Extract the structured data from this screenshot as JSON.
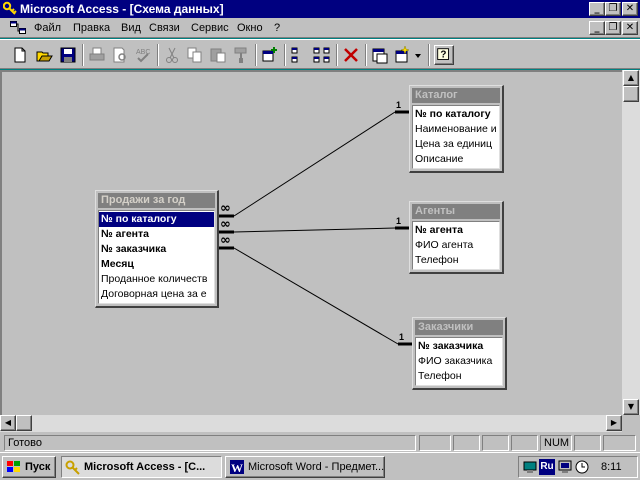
{
  "window": {
    "title": "Microsoft Access - [Схема данных]",
    "controls": {
      "minimize": "_",
      "restore": "❐",
      "close": "✕"
    }
  },
  "menu": {
    "items": [
      {
        "label": "Файл"
      },
      {
        "label": "Правка"
      },
      {
        "label": "Вид"
      },
      {
        "label": "Связи"
      },
      {
        "label": "Сервис"
      },
      {
        "label": "Окно"
      },
      {
        "label": "?"
      }
    ]
  },
  "toolbar": {
    "icons": [
      "new-icon",
      "open-icon",
      "save-icon",
      "print-icon",
      "print-preview-icon",
      "spelling-icon",
      "cut-icon",
      "copy-icon",
      "paste-icon",
      "format-painter-icon",
      "show-table-icon",
      "show-direct-icon",
      "show-all-icon",
      "delete-icon",
      "properties-icon",
      "new-object-icon",
      "help-icon"
    ]
  },
  "tables": {
    "sales": {
      "title": "Продажи за год",
      "fields": [
        "№ по каталогу",
        "№ агента",
        "№ заказчика",
        "Месяц",
        "Проданное количеств",
        "Договорная цена за е"
      ]
    },
    "catalog": {
      "title": "Каталог",
      "fields": [
        "№ по каталогу",
        "Наименование и",
        "Цена за единиц",
        "Описание"
      ]
    },
    "agents": {
      "title": "Агенты",
      "fields": [
        "№ агента",
        "ФИО агента",
        "Телефон"
      ]
    },
    "customers": {
      "title": "Заказчики",
      "fields": [
        "№ заказчика",
        "ФИО заказчика",
        "Телефон"
      ]
    }
  },
  "relations": {
    "one_label": "1",
    "many_label": "∞"
  },
  "status": {
    "text": "Готово",
    "num": "NUM"
  },
  "taskbar": {
    "start": "Пуск",
    "buttons": [
      {
        "label": "Microsoft Access - [С...",
        "active": true
      },
      {
        "label": "Microsoft Word - Предмет...",
        "active": false
      }
    ],
    "tray": {
      "lang": "Ru",
      "time": "8:11"
    }
  },
  "colors": {
    "title_bar": "#000080",
    "selection": "#000080",
    "face": "#c0c0c0",
    "desktop": "#008080"
  }
}
